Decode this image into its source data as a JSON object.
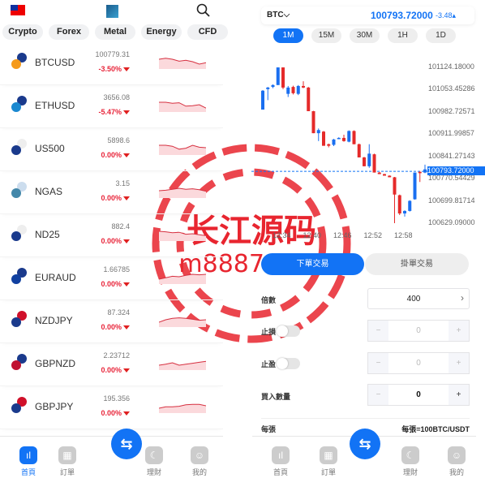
{
  "market": {
    "categories": [
      "Crypto",
      "Forex",
      "Metal",
      "Energy",
      "CFD"
    ],
    "items": [
      {
        "symbol": "BTCUSD",
        "price": "100779.31",
        "change": "-3.50%",
        "spark": [
          5,
          5.2,
          5,
          4.6,
          4.8,
          4.5,
          4,
          4.3
        ]
      },
      {
        "symbol": "ETHUSD",
        "price": "3656.08",
        "change": "-5.47%",
        "spark": [
          5,
          5,
          4.8,
          4.9,
          4.2,
          4.3,
          4.5,
          3.8
        ]
      },
      {
        "symbol": "US500",
        "price": "5898.6",
        "change": "0.00%",
        "spark": [
          5,
          5,
          4.8,
          4.2,
          4.4,
          5,
          4.6,
          4.5
        ]
      },
      {
        "symbol": "NGAS",
        "price": "3.15",
        "change": "0.00%",
        "spark": [
          4.5,
          4.6,
          4.8,
          5,
          4.8,
          4.9,
          4.7,
          4.4
        ]
      },
      {
        "symbol": "ND25",
        "price": "882.4",
        "change": "0.00%",
        "spark": [
          5,
          4.9,
          4.7,
          4.8,
          4.4,
          4.5,
          4.3,
          4.1
        ]
      },
      {
        "symbol": "EURAUD",
        "price": "1.66785",
        "change": "0.00%",
        "spark": [
          4,
          4.3,
          4.6,
          4.5,
          4.8,
          5,
          4.9,
          5
        ]
      },
      {
        "symbol": "NZDJPY",
        "price": "87.324",
        "change": "0.00%",
        "spark": [
          4,
          4.5,
          4.8,
          4.9,
          4.8,
          4.6,
          4.4,
          4.5
        ]
      },
      {
        "symbol": "GBPNZD",
        "price": "2.23712",
        "change": "0.00%",
        "spark": [
          4,
          4.2,
          4.5,
          4,
          4.2,
          4.4,
          4.6,
          4.8
        ]
      },
      {
        "symbol": "GBPJPY",
        "price": "195.356",
        "change": "0.00%",
        "spark": [
          4,
          4.3,
          4.3,
          4.4,
          4.7,
          4.8,
          4.8,
          4.5
        ]
      }
    ]
  },
  "nav": {
    "items": [
      "首頁",
      "訂單",
      "理財",
      "我的"
    ],
    "active": "首頁"
  },
  "trade": {
    "symbol": "BTC",
    "price": "100793.72000",
    "change": "-3.48",
    "timeframes": [
      "1M",
      "15M",
      "30M",
      "1H",
      "1D"
    ],
    "active_timeframe": "1M",
    "tabs": [
      "下單交易",
      "掛單交易"
    ],
    "leverage_label": "倍數",
    "leverage_value": "400",
    "stop_loss_label": "止損",
    "stop_loss_value": "0",
    "take_profit_label": "止盈",
    "take_profit_value": "0",
    "quantity_label": "買入數量",
    "quantity_value": "0",
    "per_lot_label": "每張",
    "per_lot_value": "每張=100BTC/USDT",
    "minus": "−",
    "plus": "+"
  },
  "chart_data": {
    "type": "candlestick",
    "y_ticks": [
      "101124.18000",
      "101053.45286",
      "100982.72571",
      "100911.99857",
      "100841.27143",
      "100770.54429",
      "100699.81714",
      "100629.09000"
    ],
    "x_ticks": [
      "12:34",
      "12:40",
      "12:46",
      "12:52",
      "12:58"
    ],
    "ylim": [
      100629.09,
      101124.18
    ],
    "last_price": "100793.72000",
    "candles": [
      [
        100990,
        101052,
        100990,
        101050
      ],
      [
        101055,
        101062,
        101020,
        101060
      ],
      [
        101062,
        101070,
        101058,
        101068
      ],
      [
        101068,
        101124,
        101068,
        101124
      ],
      [
        101124,
        101124,
        101055,
        101060
      ],
      [
        101040,
        101065,
        101030,
        101060
      ],
      [
        101062,
        101066,
        101038,
        101042
      ],
      [
        101040,
        101068,
        101036,
        101065
      ],
      [
        101065,
        101080,
        101058,
        101060
      ],
      [
        101060,
        101062,
        100985,
        100985
      ],
      [
        100985,
        100986,
        100915,
        100915
      ],
      [
        100915,
        100930,
        100890,
        100925
      ],
      [
        100920,
        100922,
        100875,
        100875
      ],
      [
        100880,
        100882,
        100870,
        100875
      ],
      [
        100878,
        100897,
        100874,
        100895
      ],
      [
        100898,
        100902,
        100896,
        100900
      ],
      [
        100900,
        100910,
        100888,
        100890
      ],
      [
        100888,
        100924,
        100886,
        100922
      ],
      [
        100922,
        100924,
        100880,
        100880
      ],
      [
        100880,
        100882,
        100838,
        100838
      ],
      [
        100838,
        100840,
        100810,
        100810
      ],
      [
        100810,
        100880,
        100805,
        100850
      ],
      [
        100848,
        100850,
        100790,
        100790
      ],
      [
        100790,
        100792,
        100785,
        100785
      ],
      [
        100785,
        100786,
        100780,
        100780
      ],
      [
        100780,
        100781,
        100775,
        100775
      ],
      [
        100775,
        100776,
        100629,
        100720
      ],
      [
        100718,
        100720,
        100655,
        100660
      ],
      [
        100660,
        100670,
        100650,
        100668
      ],
      [
        100668,
        100702,
        100666,
        100700
      ],
      [
        100705,
        100790,
        100704,
        100790
      ],
      [
        100792,
        100795,
        100760,
        100788
      ],
      [
        100790,
        100815,
        100788,
        100800
      ]
    ],
    "up_color": "#1a6ff0",
    "down_color": "#e52a2a"
  },
  "watermark": {
    "text": "长江源码",
    "url": "m8887.com",
    "color": "#e8252f"
  },
  "colors": {
    "accent": "#1273f5",
    "down": "#e8253a"
  }
}
